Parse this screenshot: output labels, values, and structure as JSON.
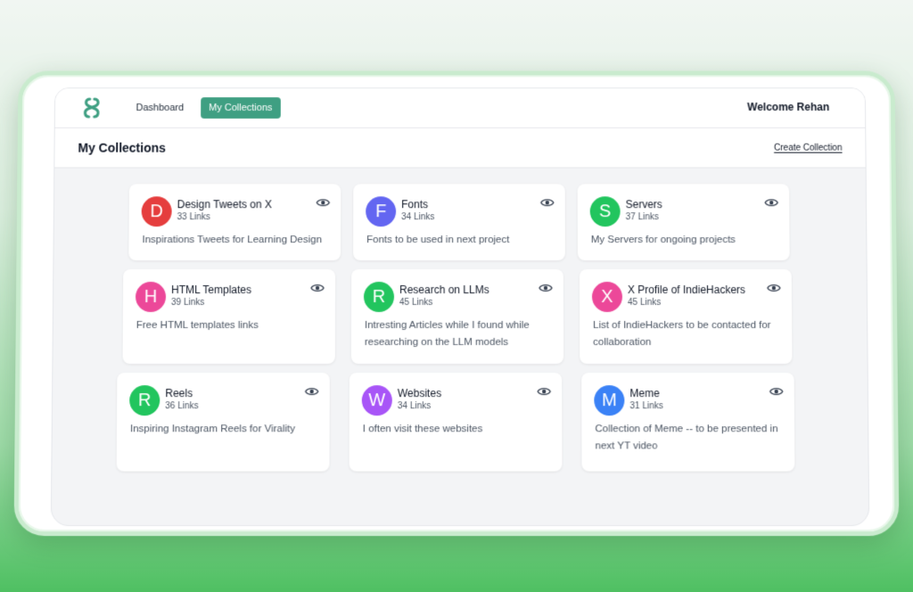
{
  "nav": {
    "items": [
      {
        "label": "Dashboard",
        "active": false
      },
      {
        "label": "My Collections",
        "active": true
      }
    ],
    "welcome": "Welcome Rehan"
  },
  "header": {
    "title": "My Collections",
    "create_label": "Create Collection"
  },
  "colors": {
    "accent": "#3f9f82"
  },
  "collections": [
    {
      "initial": "D",
      "title": "Design Tweets on X",
      "links": "33 Links",
      "description": "Inspirations Tweets for Learning Design",
      "color": "#e53e3e"
    },
    {
      "initial": "F",
      "title": "Fonts",
      "links": "34 Links",
      "description": "Fonts to be used in next project",
      "color": "#6366f1"
    },
    {
      "initial": "S",
      "title": "Servers",
      "links": "37 Links",
      "description": "My Servers for ongoing projects",
      "color": "#22c55e"
    },
    {
      "initial": "H",
      "title": "HTML Templates",
      "links": "39 Links",
      "description": "Free HTML templates links",
      "color": "#ec4899"
    },
    {
      "initial": "R",
      "title": "Research on LLMs",
      "links": "45 Links",
      "description": "Intresting Articles while I found while researching on the LLM models",
      "color": "#22c55e"
    },
    {
      "initial": "X",
      "title": "X Profile of IndieHackers",
      "links": "45 Links",
      "description": "List of IndieHackers to be contacted for collaboration",
      "color": "#ec4899"
    },
    {
      "initial": "R",
      "title": "Reels",
      "links": "36 Links",
      "description": "Inspiring Instagram Reels for Virality",
      "color": "#22c55e"
    },
    {
      "initial": "W",
      "title": "Websites",
      "links": "34 Links",
      "description": "I often visit these websites",
      "color": "#a855f7"
    },
    {
      "initial": "M",
      "title": "Meme",
      "links": "31 Links",
      "description": "Collection of Meme -- to be presented in next YT video",
      "color": "#3b82f6"
    }
  ]
}
